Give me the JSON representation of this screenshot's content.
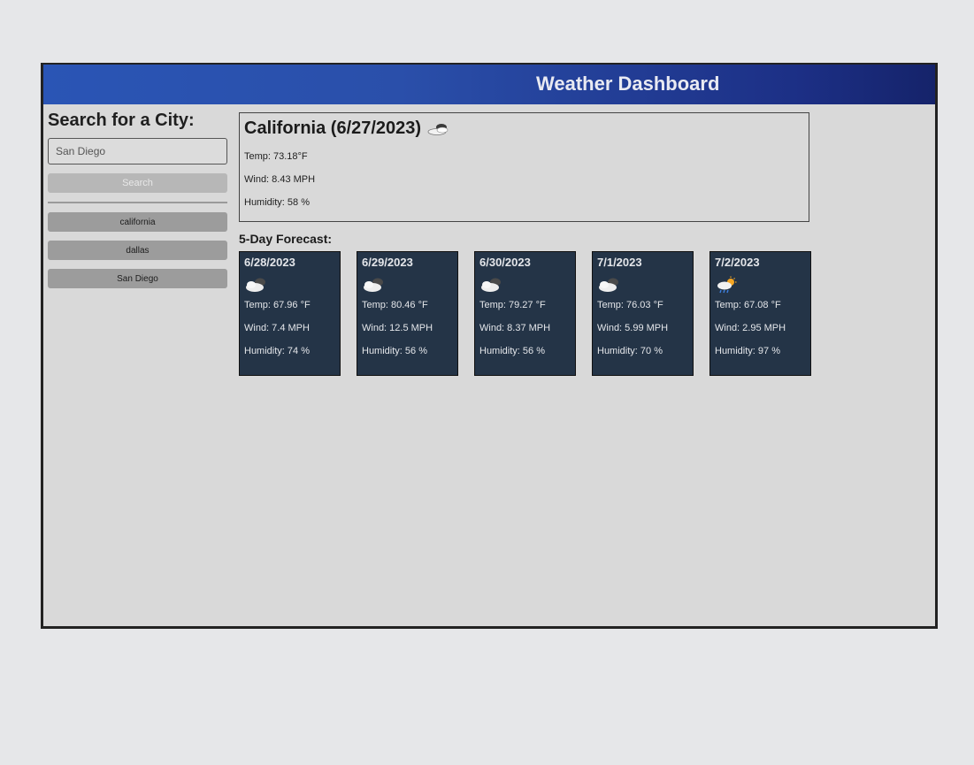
{
  "header": {
    "title": "Weather Dashboard"
  },
  "sidebar": {
    "heading": "Search for a City:",
    "input_value": "San Diego",
    "search_label": "Search",
    "history": [
      "california",
      "dallas",
      "San Diego"
    ]
  },
  "current": {
    "title": "California (6/27/2023)",
    "icon": "cloud-moon-icon",
    "temp": "Temp: 73.18°F",
    "wind": "Wind: 8.43 MPH",
    "humidity": "Humidity: 58 %"
  },
  "forecast": {
    "title": "5-Day Forecast:",
    "days": [
      {
        "date": "6/28/2023",
        "icon": "cloudy-icon",
        "temp": "Temp: 67.96 °F",
        "wind": "Wind: 7.4 MPH",
        "humidity": "Humidity: 74 %"
      },
      {
        "date": "6/29/2023",
        "icon": "cloudy-icon",
        "temp": "Temp: 80.46 °F",
        "wind": "Wind: 12.5 MPH",
        "humidity": "Humidity: 56 %"
      },
      {
        "date": "6/30/2023",
        "icon": "cloudy-icon",
        "temp": "Temp: 79.27 °F",
        "wind": "Wind: 8.37 MPH",
        "humidity": "Humidity: 56 %"
      },
      {
        "date": "7/1/2023",
        "icon": "cloudy-icon",
        "temp": "Temp: 76.03 °F",
        "wind": "Wind: 5.99 MPH",
        "humidity": "Humidity: 70 %"
      },
      {
        "date": "7/2/2023",
        "icon": "rain-sun-icon",
        "temp": "Temp: 67.08 °F",
        "wind": "Wind: 2.95 MPH",
        "humidity": "Humidity: 97 %"
      }
    ]
  },
  "colors": {
    "header_start": "#2a55b5",
    "header_end": "#15236a",
    "card_bg": "#243447",
    "page_bg": "#d9d9d9"
  }
}
